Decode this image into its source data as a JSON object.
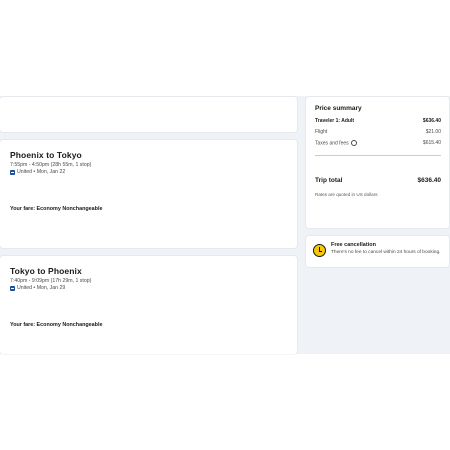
{
  "outbound": {
    "title": "Phoenix to Tokyo",
    "time": "7:55pm - 4:50pm (28h 55m, 1 stop)",
    "meta": "United • Mon, Jan 22",
    "fare": "Your fare: Economy Nonchangeable"
  },
  "return": {
    "title": "Tokyo to Phoenix",
    "time": "7:40pm - 9:09pm (17h 29m, 1 stop)",
    "meta": "United • Mon, Jan 29",
    "fare": "Your fare: Economy Nonchangeable"
  },
  "price_summary": {
    "title": "Price summary",
    "traveler_label": "Traveler 1: Adult",
    "traveler_value": "$636.40",
    "flight_label": "Flight",
    "flight_value": "$21.00",
    "taxes_label": "Taxes and fees",
    "taxes_value": "$615.40",
    "total_label": "Trip total",
    "total_value": "$636.40",
    "note": "Rates are quoted in US dollars"
  },
  "cancellation": {
    "title": "Free cancellation",
    "text": "There's no fee to cancel within 24 hours of booking."
  },
  "colors": {
    "panel_bg": "#eff2f6",
    "clock_yellow": "#f6c70c",
    "airline_blue": "#1b4fa0"
  },
  "icons": {
    "airline": "united-airline-icon",
    "info": "info-icon",
    "clock": "clock-icon"
  }
}
